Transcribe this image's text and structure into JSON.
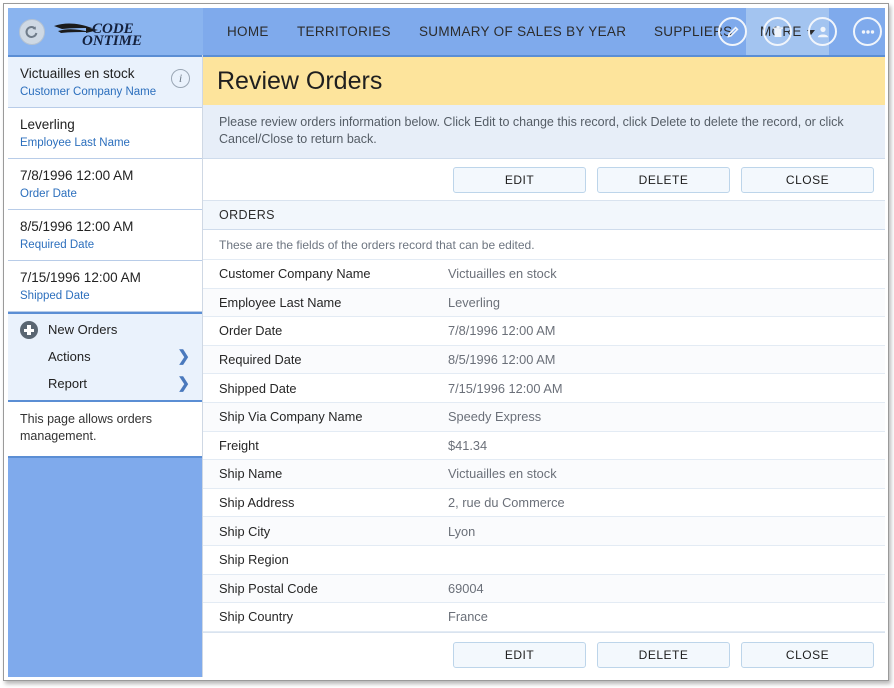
{
  "window": {
    "title": "Review Orders"
  },
  "topbar": {
    "back_label": "back-arrow",
    "logo_line1": "CODE",
    "logo_line2": "ONTIME",
    "nav": [
      {
        "label": "HOME",
        "active": false
      },
      {
        "label": "TERRITORIES",
        "active": false
      },
      {
        "label": "SUMMARY OF SALES BY YEAR",
        "active": false
      },
      {
        "label": "SUPPLIERS",
        "active": false
      },
      {
        "label": "MORE",
        "active": true,
        "has_caret": true
      }
    ],
    "tools": [
      {
        "name": "edit-icon",
        "glyph": "pencil"
      },
      {
        "name": "delete-icon",
        "glyph": "trash"
      },
      {
        "name": "user-icon",
        "glyph": "person"
      },
      {
        "name": "more-icon",
        "glyph": "ellipsis"
      }
    ]
  },
  "sidebar": {
    "records": [
      {
        "value": "Victuailles en stock",
        "label": "Customer Company Name",
        "selected": true,
        "info": "i"
      },
      {
        "value": "Leverling",
        "label": "Employee Last Name",
        "selected": false
      },
      {
        "value": "7/8/1996 12:00 AM",
        "label": "Order Date",
        "selected": false
      },
      {
        "value": "8/5/1996 12:00 AM",
        "label": "Required Date",
        "selected": false
      },
      {
        "value": "7/15/1996 12:00 AM",
        "label": "Shipped Date",
        "selected": false
      }
    ],
    "actions": [
      {
        "label": "New Orders",
        "icon": "plus-icon",
        "chevron": false
      },
      {
        "label": "Actions",
        "icon": "",
        "chevron": true
      },
      {
        "label": "Report",
        "icon": "",
        "chevron": true
      }
    ],
    "description": "This page allows orders management."
  },
  "main": {
    "page_title": "Review Orders",
    "page_description": "Please review orders information below. Click Edit to change this record, click Delete to delete the record, or click Cancel/Close to return back.",
    "buttons": [
      {
        "label": "EDIT",
        "name": "edit-button"
      },
      {
        "label": "DELETE",
        "name": "delete-button"
      },
      {
        "label": "CLOSE",
        "name": "close-button"
      }
    ],
    "section_header": "ORDERS",
    "section_description": "These are the fields of the orders record that can be edited.",
    "fields": [
      {
        "label": "Customer Company Name",
        "value": "Victuailles en stock"
      },
      {
        "label": "Employee Last Name",
        "value": "Leverling"
      },
      {
        "label": "Order Date",
        "value": "7/8/1996 12:00 AM"
      },
      {
        "label": "Required Date",
        "value": "8/5/1996 12:00 AM"
      },
      {
        "label": "Shipped Date",
        "value": "7/15/1996 12:00 AM"
      },
      {
        "label": "Ship Via Company Name",
        "value": "Speedy Express"
      },
      {
        "label": "Freight",
        "value": "$41.34"
      },
      {
        "label": "Ship Name",
        "value": "Victuailles en stock"
      },
      {
        "label": "Ship Address",
        "value": "2, rue du Commerce"
      },
      {
        "label": "Ship City",
        "value": "Lyon"
      },
      {
        "label": "Ship Region",
        "value": ""
      },
      {
        "label": "Ship Postal Code",
        "value": "69004"
      },
      {
        "label": "Ship Country",
        "value": "France"
      }
    ]
  },
  "colors": {
    "brand_blue": "#7faaec",
    "title_yellow": "#fde49c",
    "link_blue": "#2c6fbd",
    "accent_border": "#5b8ed4"
  }
}
